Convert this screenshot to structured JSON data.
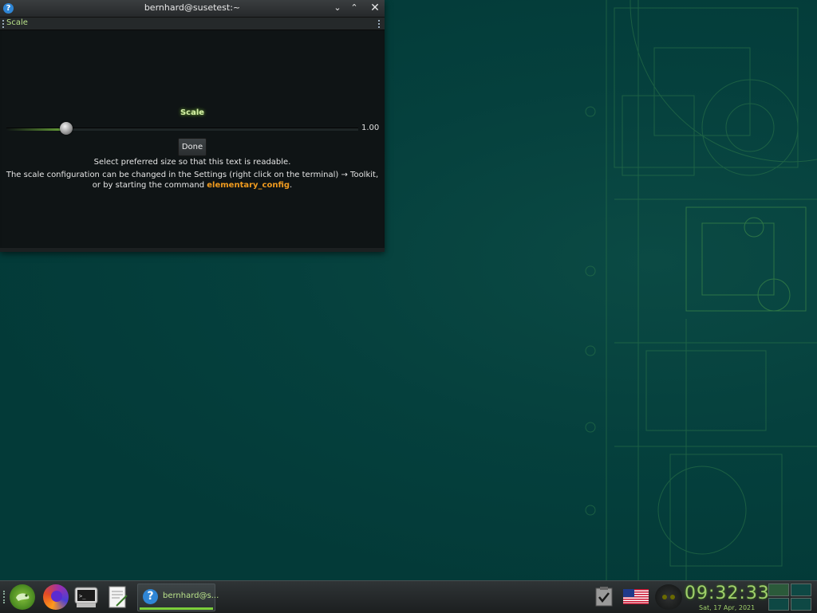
{
  "window": {
    "title": "bernhard@susetest:~",
    "help_glyph": "?",
    "minimize_glyph": "⌄",
    "maximize_glyph": "⌃",
    "close_glyph": "✕",
    "tab_label": "Scale"
  },
  "dialog": {
    "heading": "Scale",
    "slider_value_text": "1.00",
    "slider_fraction": 0.17,
    "done_label": "Done",
    "message_line1": "Select preferred size so that this text is readable.",
    "message_line2_pre": "The scale configuration can be changed in the Settings (right click on the terminal) → Toolkit, or by starting the command ",
    "message_command": "elementary_config",
    "message_line2_post": "."
  },
  "taskbar": {
    "launchers": [
      "suse-icon",
      "firefox-icon",
      "terminal-icon",
      "text-editor-icon"
    ],
    "task_label": "bernhard@s...",
    "task_glyph": "?",
    "clock_time": "09:32:33",
    "clock_date": "Sat, 17 Apr, 2021"
  },
  "colors": {
    "accent_green": "#7ccf3b",
    "command_orange": "#f09b1f",
    "desktop_teal": "#033a38"
  }
}
